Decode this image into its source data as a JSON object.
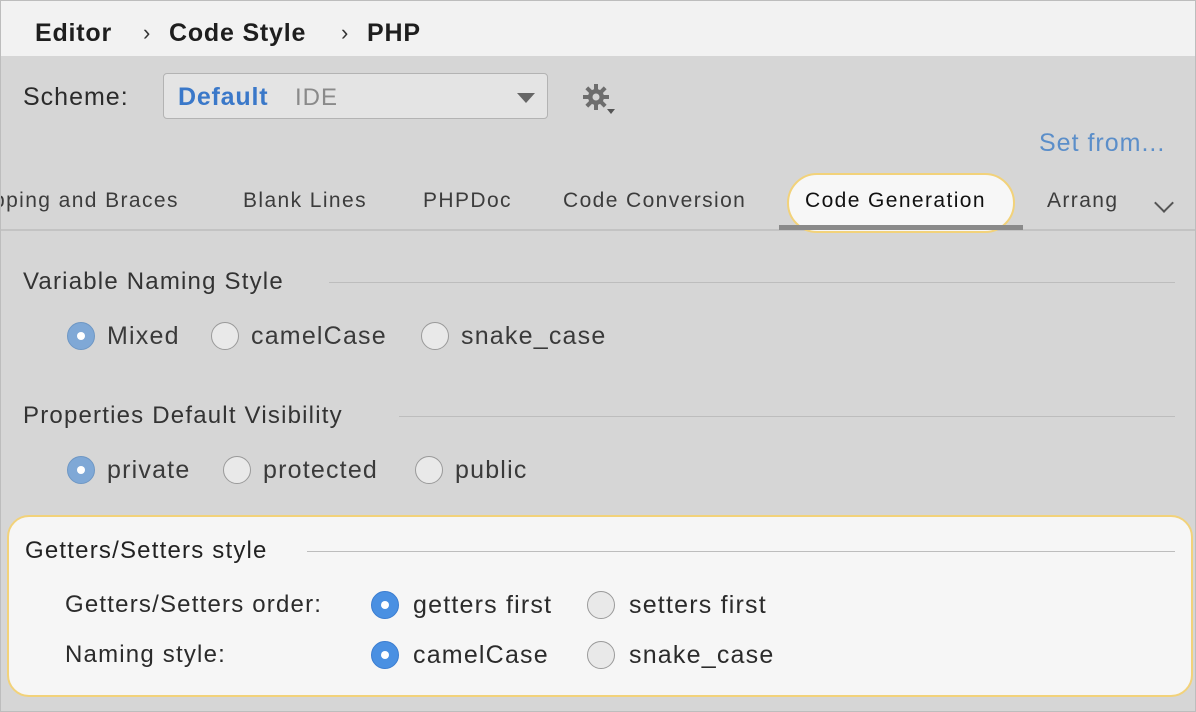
{
  "breadcrumb": {
    "items": [
      "Editor",
      "Code Style",
      "PHP"
    ],
    "separator": "›"
  },
  "scheme": {
    "label": "Scheme:",
    "name": "Default",
    "type": "IDE",
    "gear_icon": "gear-icon"
  },
  "set_from": "Set from...",
  "tabs": {
    "items": [
      "pping and Braces",
      "Blank Lines",
      "PHPDoc",
      "Code Conversion",
      "Code Generation",
      "Arrang"
    ],
    "active": "Code Generation",
    "more_icon": "chevron-down-icon"
  },
  "variable_naming": {
    "title": "Variable Naming Style",
    "options": [
      "Mixed",
      "camelCase",
      "snake_case"
    ],
    "selected": "Mixed"
  },
  "properties_visibility": {
    "title": "Properties Default Visibility",
    "options": [
      "private",
      "protected",
      "public"
    ],
    "selected": "private"
  },
  "getters_setters": {
    "title": "Getters/Setters style",
    "order": {
      "label": "Getters/Setters order:",
      "options": [
        "getters first",
        "setters first"
      ],
      "selected": "getters first"
    },
    "naming": {
      "label": "Naming style:",
      "options": [
        "camelCase",
        "snake_case"
      ],
      "selected": "camelCase"
    }
  },
  "colors": {
    "accent": "#4a90e2",
    "highlight_border": "#f2d27a",
    "link": "#5b8ec9"
  }
}
